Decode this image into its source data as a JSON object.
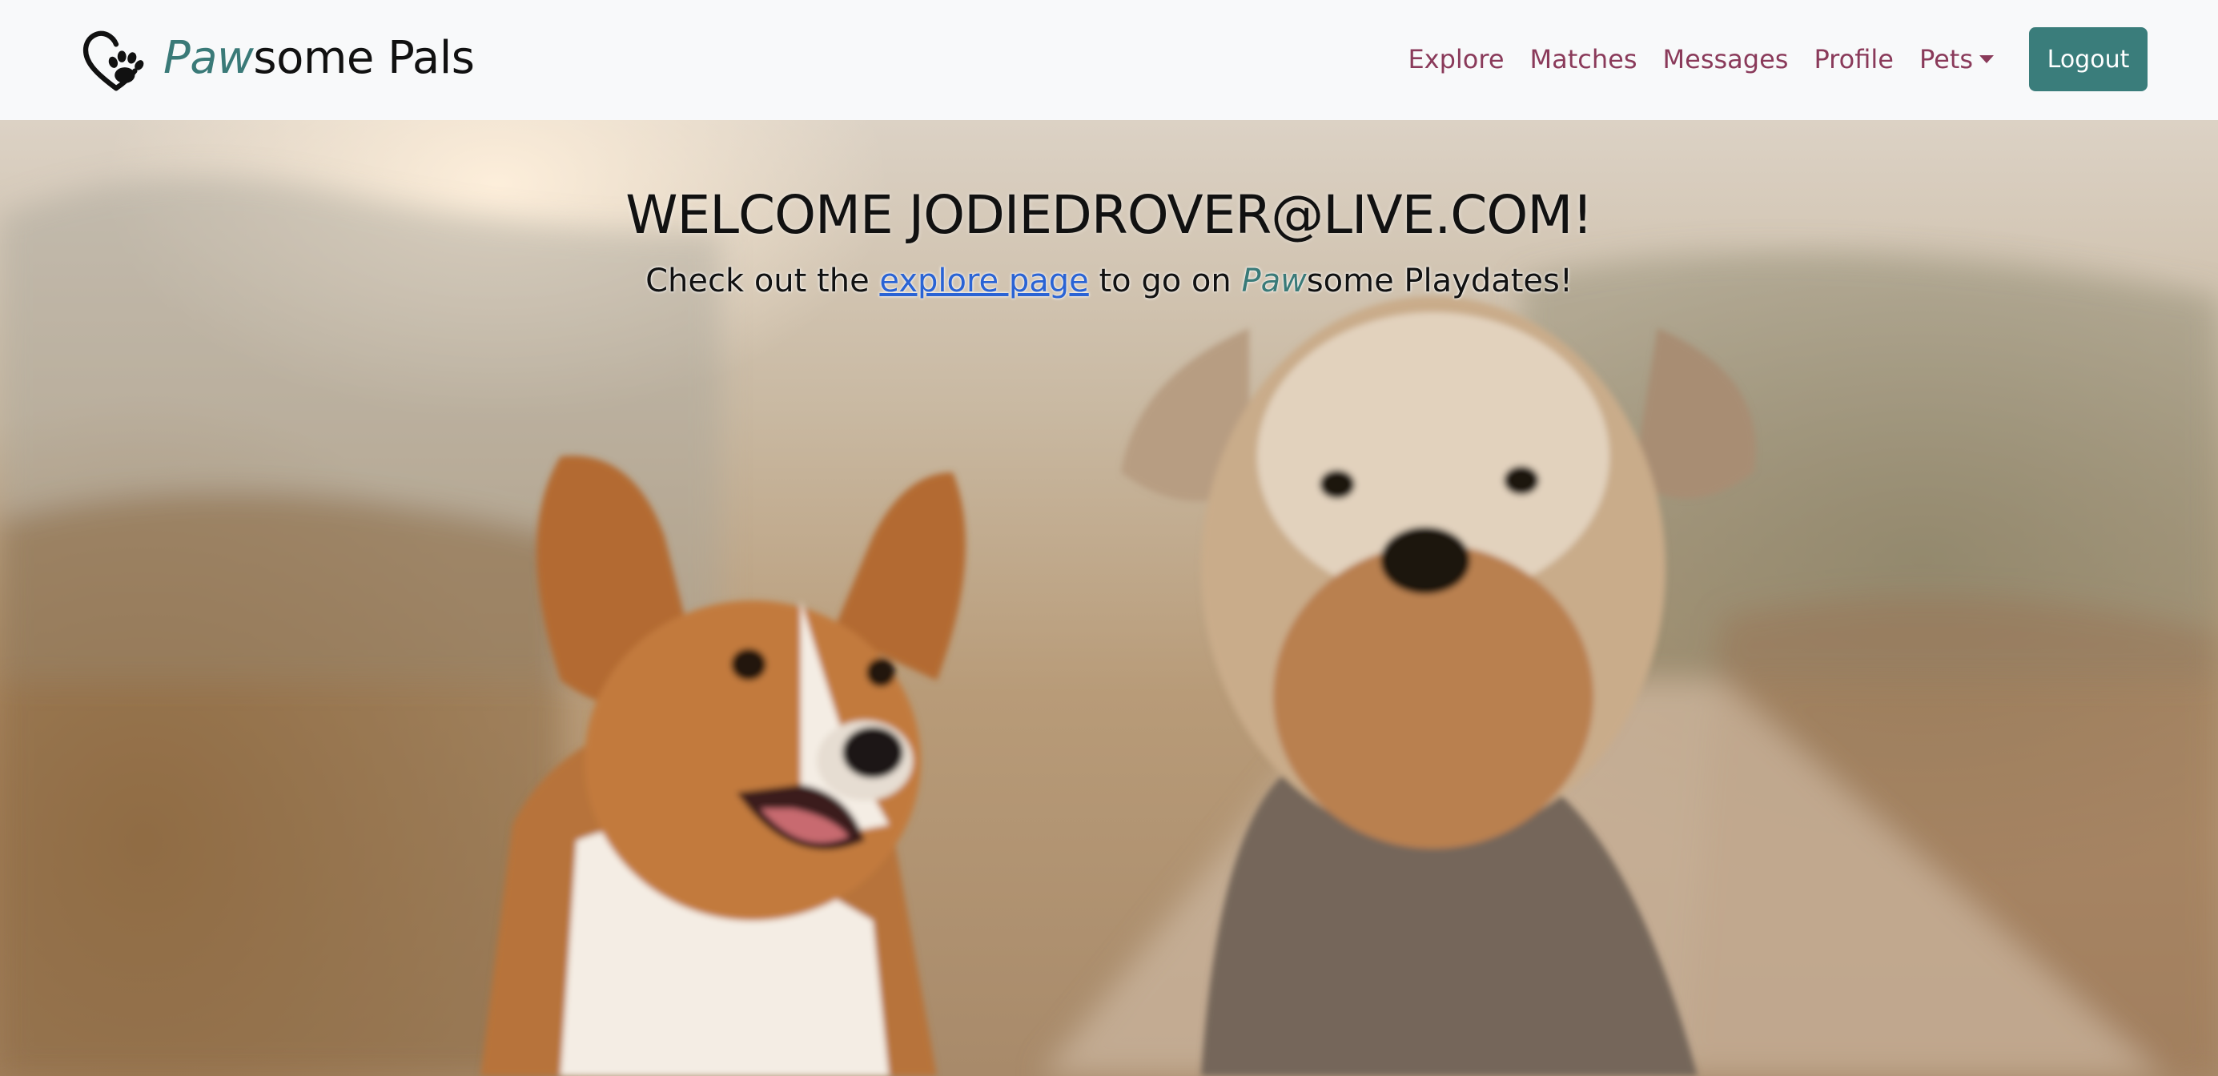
{
  "brand": {
    "name_accent": "Paw",
    "name_rest": "some Pals",
    "logo_icon": "heart-paw-icon"
  },
  "nav": {
    "links": [
      "Explore",
      "Matches",
      "Messages",
      "Profile",
      "Pets"
    ],
    "logout_label": "Logout"
  },
  "hero": {
    "welcome": "WELCOME JODIEDROVER@LIVE.COM!",
    "subtitle_before": "Check out the ",
    "subtitle_link": "explore page",
    "subtitle_middle": " to go on ",
    "subtitle_accent": "Paw",
    "subtitle_after": "some Playdates!",
    "image": "two-dogs-photo"
  },
  "colors": {
    "navbar_bg": "#f8f9fa",
    "nav_link": "#8a3a5a",
    "accent_teal": "#3a7d7b",
    "link_blue": "#2a63d4"
  }
}
